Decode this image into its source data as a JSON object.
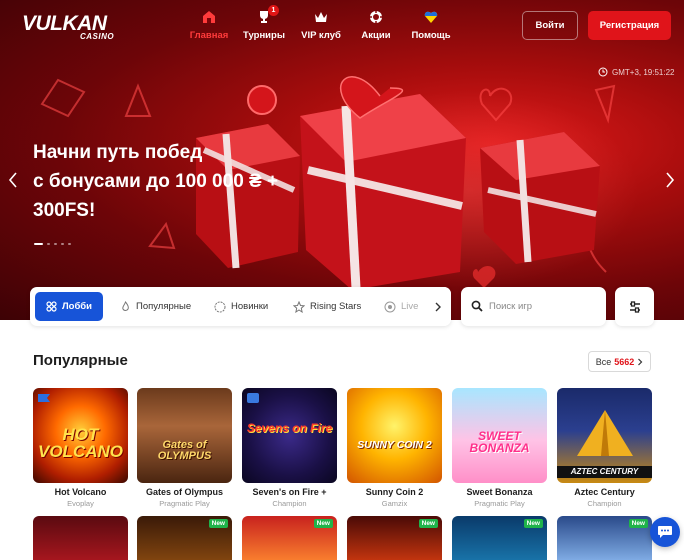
{
  "brand": {
    "logo_main": "VULKAN",
    "logo_sub": "CASINO"
  },
  "nav": [
    {
      "label": "Главная",
      "icon": "casino-house-icon",
      "active": true
    },
    {
      "label": "Турниры",
      "icon": "trophy-icon",
      "badge": "1"
    },
    {
      "label": "VIP клуб",
      "icon": "crown-icon"
    },
    {
      "label": "Акции",
      "icon": "chip-icon"
    },
    {
      "label": "Помощь",
      "icon": "ukraine-heart-icon"
    }
  ],
  "auth": {
    "login": "Войти",
    "register": "Регистрация"
  },
  "hero": {
    "time": "GMT+3, 19:51:22",
    "headline_line1": "Начни путь побед",
    "headline_line2": "с бонусами до 100 000 ₴ +",
    "headline_line3": "300FS!",
    "slides": 5,
    "active_slide": 1
  },
  "categories": {
    "active": "Лобби",
    "items": [
      "Популярные",
      "Новинки",
      "Rising Stars",
      "Live"
    ]
  },
  "search": {
    "placeholder": "Поиск игр"
  },
  "section": {
    "title": "Популярные",
    "all_label": "Все",
    "all_count": "5662"
  },
  "games": [
    {
      "name": "Hot Volcano",
      "provider": "Evoplay",
      "art_text": "HOT VOLCANO"
    },
    {
      "name": "Gates of Olympus",
      "provider": "Pragmatic Play",
      "art_text": "Gates of OLYMPUS"
    },
    {
      "name": "Seven's on Fire +",
      "provider": "Champion",
      "art_text": "Sevens on Fire"
    },
    {
      "name": "Sunny Coin 2",
      "provider": "Gamzix",
      "art_text": "SUNNY COIN 2"
    },
    {
      "name": "Sweet Bonanza",
      "provider": "Pragmatic Play",
      "art_text": "SWEET BONANZA"
    },
    {
      "name": "Aztec Century",
      "provider": "Champion",
      "art_text": "AZTEC CENTURY"
    }
  ],
  "row2_tags": [
    "",
    "New",
    "New",
    "New",
    "New",
    "New"
  ],
  "colors": {
    "accent_red": "#e0141a",
    "accent_blue": "#1754d8",
    "new_green": "#1fb34a"
  }
}
